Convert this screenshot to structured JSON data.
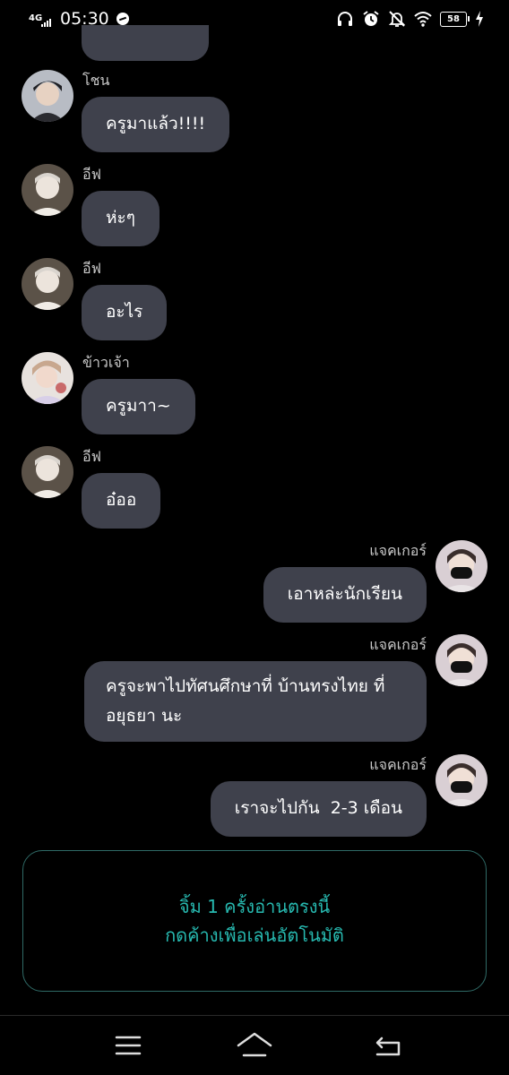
{
  "status_bar": {
    "network": "4G",
    "time": "05:30",
    "battery": "58",
    "icons": [
      "messenger-icon",
      "headphones-icon",
      "alarm-icon",
      "mute-icon",
      "wifi-icon",
      "battery-icon",
      "charging-icon"
    ]
  },
  "messages": [
    {
      "direction": "in",
      "sender": "โชน",
      "text": "ครูมาแล้ว!!!!",
      "avatar": "avatar-chon"
    },
    {
      "direction": "in",
      "sender": "อีฟ",
      "text": "ห่ะๆ",
      "avatar": "avatar-eve"
    },
    {
      "direction": "in",
      "sender": "อีฟ",
      "text": "อะไร",
      "avatar": "avatar-eve"
    },
    {
      "direction": "in",
      "sender": "ข้าวเจ้า",
      "text": "ครูมาา~",
      "avatar": "avatar-khaochao"
    },
    {
      "direction": "in",
      "sender": "อีฟ",
      "text": "อ๋ออ",
      "avatar": "avatar-eve"
    },
    {
      "direction": "out",
      "sender": "แจคเกอร์",
      "text": "เอาหล่ะนักเรียน",
      "avatar": "avatar-jacker"
    },
    {
      "direction": "out",
      "sender": "แจคเกอร์",
      "text_lines": [
        "ครูจะพาไปทัศนศึกษาที่ บ้านทรงไทย ที่",
        "อยุธยา นะ"
      ],
      "avatar": "avatar-jacker"
    },
    {
      "direction": "out",
      "sender": "แจคเกอร์",
      "text": "เราจะไปกัน  2-3 เดือน",
      "avatar": "avatar-jacker"
    }
  ],
  "read_prompt": {
    "line1": "จิ้ม 1 ครั้งอ่านตรงนี้",
    "line2": "กดค้างเพื่อเล่นอัตโนมัติ"
  },
  "colors": {
    "background": "#000000",
    "bubble": "#3f414c",
    "prompt_text": "#27b9b0",
    "prompt_border": "#2f6a66"
  },
  "nav_bar": {
    "icons": [
      "menu-icon",
      "home-icon",
      "back-icon"
    ]
  }
}
